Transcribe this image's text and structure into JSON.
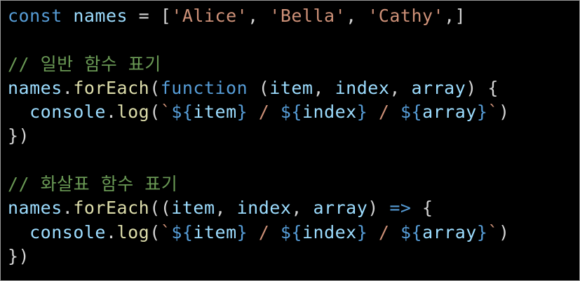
{
  "code_lines": [
    {
      "tokens": [
        {
          "t": "const",
          "c": "kw"
        },
        {
          "t": " ",
          "c": "pun"
        },
        {
          "t": "names",
          "c": "var"
        },
        {
          "t": " = [",
          "c": "pun"
        },
        {
          "t": "'Alice'",
          "c": "str"
        },
        {
          "t": ", ",
          "c": "pun"
        },
        {
          "t": "'Bella'",
          "c": "str"
        },
        {
          "t": ", ",
          "c": "pun"
        },
        {
          "t": "'Cathy'",
          "c": "str"
        },
        {
          "t": ",]",
          "c": "pun"
        }
      ]
    },
    {
      "tokens": []
    },
    {
      "tokens": [
        {
          "t": "// 일반 함수 표기",
          "c": "cmt"
        }
      ]
    },
    {
      "tokens": [
        {
          "t": "names",
          "c": "var"
        },
        {
          "t": ".",
          "c": "pun"
        },
        {
          "t": "forEach",
          "c": "fn"
        },
        {
          "t": "(",
          "c": "pun"
        },
        {
          "t": "function",
          "c": "kw"
        },
        {
          "t": " (",
          "c": "pun"
        },
        {
          "t": "item",
          "c": "var"
        },
        {
          "t": ", ",
          "c": "pun"
        },
        {
          "t": "index",
          "c": "var"
        },
        {
          "t": ", ",
          "c": "pun"
        },
        {
          "t": "array",
          "c": "var"
        },
        {
          "t": ") {",
          "c": "pun"
        }
      ]
    },
    {
      "tokens": [
        {
          "t": "  ",
          "c": "pun"
        },
        {
          "t": "console",
          "c": "var"
        },
        {
          "t": ".",
          "c": "pun"
        },
        {
          "t": "log",
          "c": "fn"
        },
        {
          "t": "(",
          "c": "pun"
        },
        {
          "t": "`",
          "c": "str"
        },
        {
          "t": "${",
          "c": "tpl-delim"
        },
        {
          "t": "item",
          "c": "var"
        },
        {
          "t": "}",
          "c": "tpl-delim"
        },
        {
          "t": " / ",
          "c": "str"
        },
        {
          "t": "${",
          "c": "tpl-delim"
        },
        {
          "t": "index",
          "c": "var"
        },
        {
          "t": "}",
          "c": "tpl-delim"
        },
        {
          "t": " / ",
          "c": "str"
        },
        {
          "t": "${",
          "c": "tpl-delim"
        },
        {
          "t": "array",
          "c": "var"
        },
        {
          "t": "}",
          "c": "tpl-delim"
        },
        {
          "t": "`",
          "c": "str"
        },
        {
          "t": ")",
          "c": "pun"
        }
      ]
    },
    {
      "tokens": [
        {
          "t": "})",
          "c": "pun"
        }
      ]
    },
    {
      "tokens": []
    },
    {
      "tokens": [
        {
          "t": "// 화살표 함수 표기",
          "c": "cmt"
        }
      ]
    },
    {
      "tokens": [
        {
          "t": "names",
          "c": "var"
        },
        {
          "t": ".",
          "c": "pun"
        },
        {
          "t": "forEach",
          "c": "fn"
        },
        {
          "t": "((",
          "c": "pun"
        },
        {
          "t": "item",
          "c": "var"
        },
        {
          "t": ", ",
          "c": "pun"
        },
        {
          "t": "index",
          "c": "var"
        },
        {
          "t": ", ",
          "c": "pun"
        },
        {
          "t": "array",
          "c": "var"
        },
        {
          "t": ") ",
          "c": "pun"
        },
        {
          "t": "=>",
          "c": "kw"
        },
        {
          "t": " {",
          "c": "pun"
        }
      ]
    },
    {
      "tokens": [
        {
          "t": "  ",
          "c": "pun"
        },
        {
          "t": "console",
          "c": "var"
        },
        {
          "t": ".",
          "c": "pun"
        },
        {
          "t": "log",
          "c": "fn"
        },
        {
          "t": "(",
          "c": "pun"
        },
        {
          "t": "`",
          "c": "str"
        },
        {
          "t": "${",
          "c": "tpl-delim"
        },
        {
          "t": "item",
          "c": "var"
        },
        {
          "t": "}",
          "c": "tpl-delim"
        },
        {
          "t": " / ",
          "c": "str"
        },
        {
          "t": "${",
          "c": "tpl-delim"
        },
        {
          "t": "index",
          "c": "var"
        },
        {
          "t": "}",
          "c": "tpl-delim"
        },
        {
          "t": " / ",
          "c": "str"
        },
        {
          "t": "${",
          "c": "tpl-delim"
        },
        {
          "t": "array",
          "c": "var"
        },
        {
          "t": "}",
          "c": "tpl-delim"
        },
        {
          "t": "`",
          "c": "str"
        },
        {
          "t": ")",
          "c": "pun"
        }
      ]
    },
    {
      "tokens": [
        {
          "t": "})",
          "c": "pun"
        }
      ]
    }
  ],
  "colors": {
    "background": "#000000",
    "keyword": "#569cd6",
    "variable": "#9cdcfe",
    "function": "#dcdcaa",
    "string": "#ce9178",
    "comment": "#6a9955",
    "punctuation": "#d4d4d4"
  }
}
